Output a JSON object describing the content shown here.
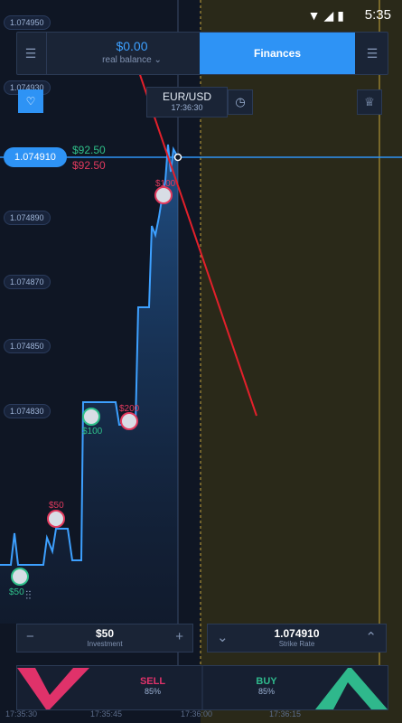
{
  "status": {
    "time": "5:35",
    "icons": "wifi-icon signal-icon battery-icon"
  },
  "header": {
    "balance_amount": "$0.00",
    "balance_label": "real balance",
    "finances_label": "Finances"
  },
  "asset": {
    "pair": "EUR/USD",
    "time": "17:36:30"
  },
  "axis": {
    "price_labels": [
      "1.074950",
      "1.074930",
      "1.074890",
      "1.074870",
      "1.074850",
      "1.074830"
    ],
    "current_price": "1.074910",
    "time_labels": [
      "17:35:30",
      "17:35:45",
      "17:36:00",
      "17:36:15"
    ]
  },
  "profit": {
    "up": "$92.50",
    "down": "$92.50"
  },
  "trades": [
    {
      "label": "$100",
      "color": "#2fc08a"
    },
    {
      "label": "$200",
      "color": "#e23a5e"
    },
    {
      "label": "$50",
      "color": "#e23a5e"
    },
    {
      "label": "$100",
      "color": "#e23a5e"
    },
    {
      "label": "$50",
      "color": "#2fc08a"
    }
  ],
  "controls": {
    "investment_value": "$50",
    "investment_label": "Investment",
    "strike_value": "1.074910",
    "strike_label": "Strike Rate"
  },
  "actions": {
    "sell_label": "SELL",
    "sell_pct": "85%",
    "buy_label": "BUY",
    "buy_pct": "85%"
  },
  "colors": {
    "accent": "#2e93f5",
    "up": "#2fc08a",
    "down": "#e23a5e",
    "expiry_zone": "#3d3a1a"
  }
}
